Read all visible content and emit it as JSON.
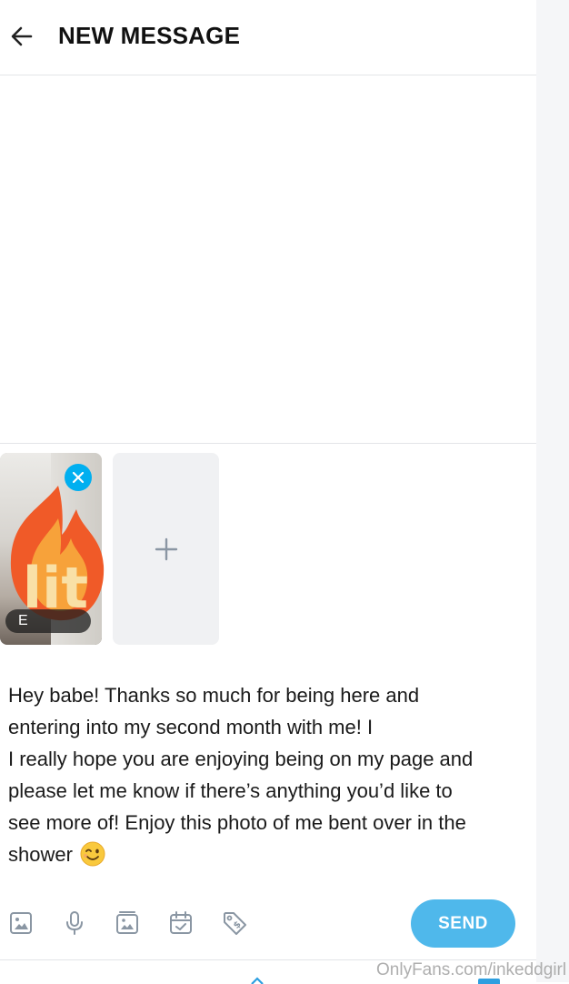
{
  "header": {
    "title": "NEW MESSAGE",
    "back_icon": "arrow-left-icon"
  },
  "attachments": {
    "items": [
      {
        "type": "image",
        "badge_text": "E",
        "sticker_text": "lit",
        "remove_icon": "close-icon"
      }
    ],
    "add_icon": "plus-icon"
  },
  "composer": {
    "text": "Hey babe! Thanks so much for being here and\nentering into my second month with me! I\nI really hope you are enjoying being on my page and\nplease let me know if there’s anything you’d like to\nsee more of! Enjoy this photo of me bent over in the\nshower",
    "emoji": "winking-face-emoji"
  },
  "toolbar": {
    "icons": [
      "image-icon",
      "microphone-icon",
      "media-vault-icon",
      "calendar-check-icon",
      "price-tag-icon"
    ],
    "send_label": "SEND"
  },
  "watermark": "OnlyFans.com/inkeddgirl",
  "colors": {
    "accent": "#00aff0",
    "send_button": "#4fb8eb",
    "icon_gray": "#8a96a3"
  }
}
